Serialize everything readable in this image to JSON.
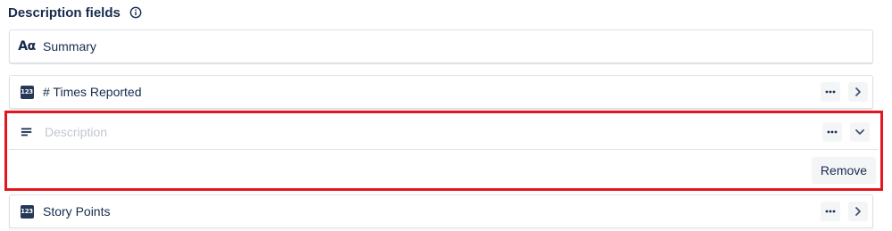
{
  "section": {
    "title": "Description fields",
    "info_icon": "info-icon"
  },
  "fields": [
    {
      "label": "Summary",
      "icon": "text-aa-icon",
      "icon_text": "Aα"
    },
    {
      "label": "# Times Reported",
      "icon": "number-icon",
      "icon_text": "123"
    },
    {
      "label": "Description",
      "icon": "paragraph-icon",
      "placeholder": true
    },
    {
      "label": "Story Points",
      "icon": "number-icon",
      "icon_text": "123"
    }
  ],
  "actions": {
    "more_icon": "more-icon",
    "expand_icon": "chevron-right-icon",
    "collapse_icon": "chevron-down-icon",
    "remove_label": "Remove"
  },
  "colors": {
    "highlight_border": "#e3161d",
    "text": "#172b4d",
    "button_bg": "#f4f5f7"
  }
}
